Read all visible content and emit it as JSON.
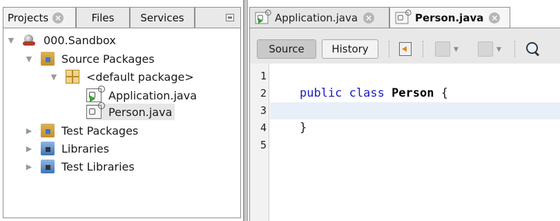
{
  "left_panel": {
    "tabs": {
      "projects": "Projects",
      "files": "Files",
      "services": "Services"
    },
    "tree": {
      "project": "000.Sandbox",
      "source_packages": "Source Packages",
      "default_package": "<default package>",
      "file_application": "Application.java",
      "file_person": "Person.java",
      "test_packages": "Test Packages",
      "libraries": "Libraries",
      "test_libraries": "Test Libraries"
    }
  },
  "editor": {
    "tabs": {
      "application": "Application.java",
      "person": "Person.java"
    },
    "toolbar": {
      "source": "Source",
      "history": "History"
    },
    "line_numbers": [
      "1",
      "2",
      "3",
      "4",
      "5"
    ],
    "code": {
      "line2_keywords": "public class ",
      "line2_class": "Person",
      "line2_rest": " {",
      "line4": "}"
    }
  },
  "icons": {
    "tab_close": "close-icon",
    "minimize": "minimize-icon",
    "last_edit": "last-edit-icon",
    "back": "back-icon",
    "forward": "forward-icon",
    "find": "search-icon"
  },
  "colors": {
    "keyword": "#1a1ac8",
    "current_line": "#e9eff8",
    "panel_bg": "#e8e8e8"
  }
}
